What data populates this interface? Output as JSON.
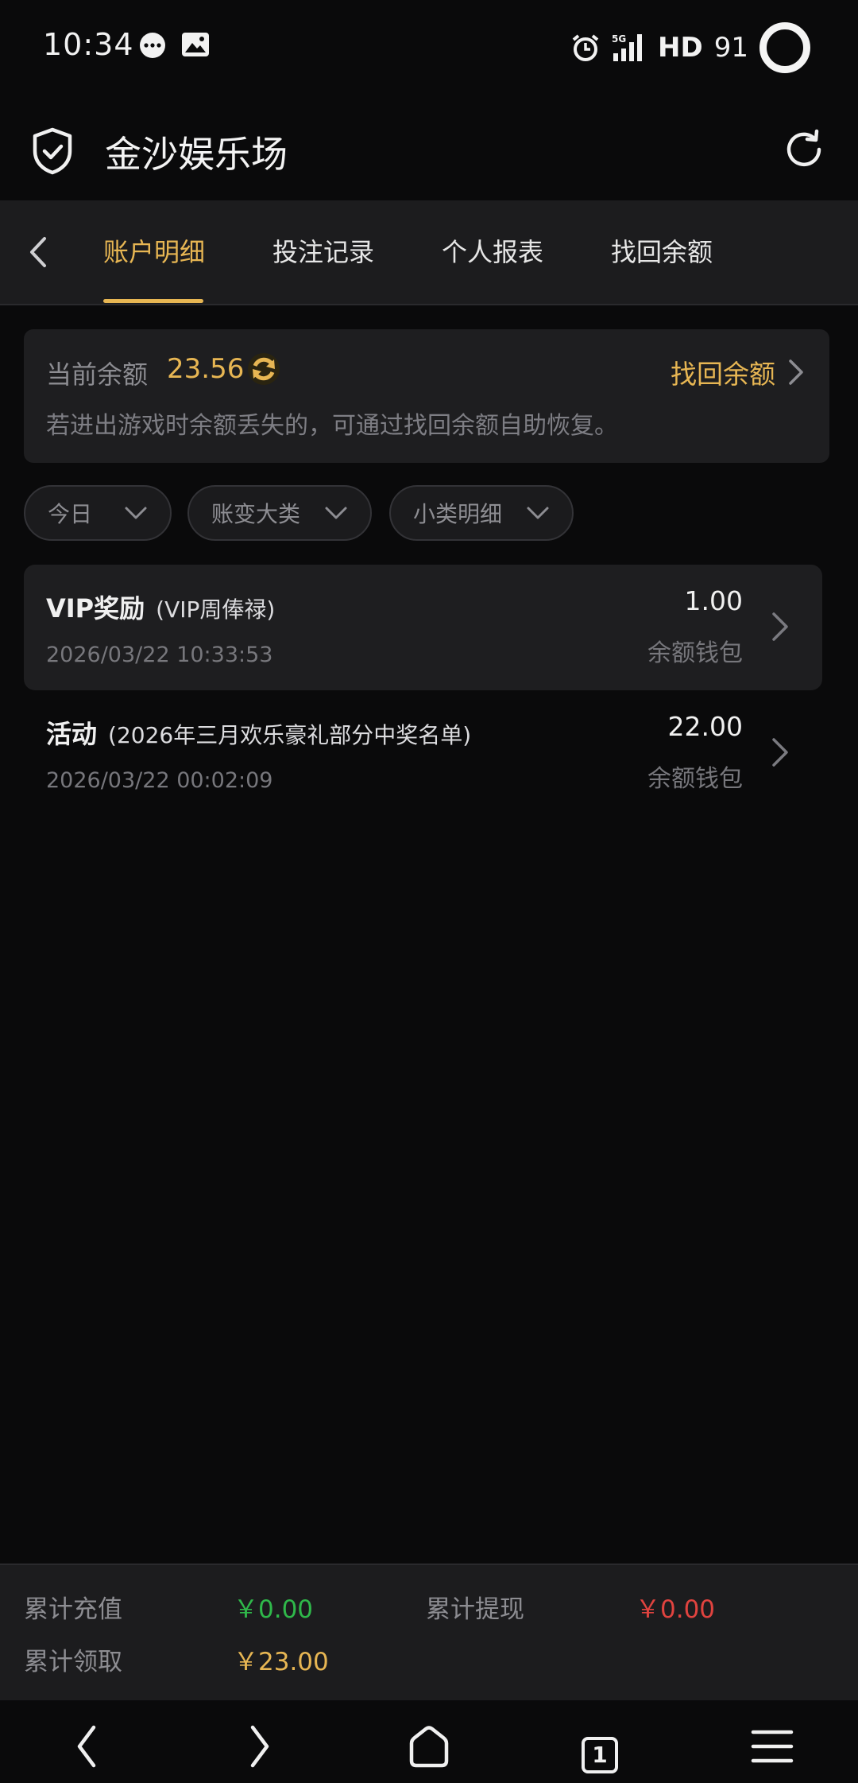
{
  "status_bar": {
    "time": "10:34",
    "network": "5G",
    "hd_label": "HD",
    "battery": "91"
  },
  "header": {
    "title": "金沙娱乐场"
  },
  "tabs": [
    {
      "label": "账户明细",
      "active": true
    },
    {
      "label": "投注记录",
      "active": false
    },
    {
      "label": "个人报表",
      "active": false
    },
    {
      "label": "找回余额",
      "active": false
    }
  ],
  "balance": {
    "label": "当前余额",
    "value": "23.56",
    "retrieve_label": "找回余额",
    "tip": "若进出游戏时余额丢失的，可通过找回余额自助恢复。"
  },
  "filters": [
    {
      "label": "今日"
    },
    {
      "label": "账变大类"
    },
    {
      "label": "小类明细"
    }
  ],
  "records": [
    {
      "title": "VIP奖励",
      "subtitle": "(VIP周俸禄)",
      "date": "2026/03/22 10:33:53",
      "amount": "1.00",
      "wallet": "余额钱包"
    },
    {
      "title": "活动",
      "subtitle": "(2026年三月欢乐豪礼部分中奖名单)",
      "date": "2026/03/22 00:02:09",
      "amount": "22.00",
      "wallet": "余额钱包"
    }
  ],
  "summary": {
    "recharge_label": "累计充值",
    "recharge_value": "￥0.00",
    "withdraw_label": "累计提现",
    "withdraw_value": "￥0.00",
    "claim_label": "累计领取",
    "claim_value": "￥23.00"
  },
  "bottom_nav": {
    "tab_count": "1"
  },
  "colors": {
    "accent": "#e7b653",
    "green": "#2fb84a",
    "red": "#e0433f",
    "background": "#0a0a0b"
  }
}
